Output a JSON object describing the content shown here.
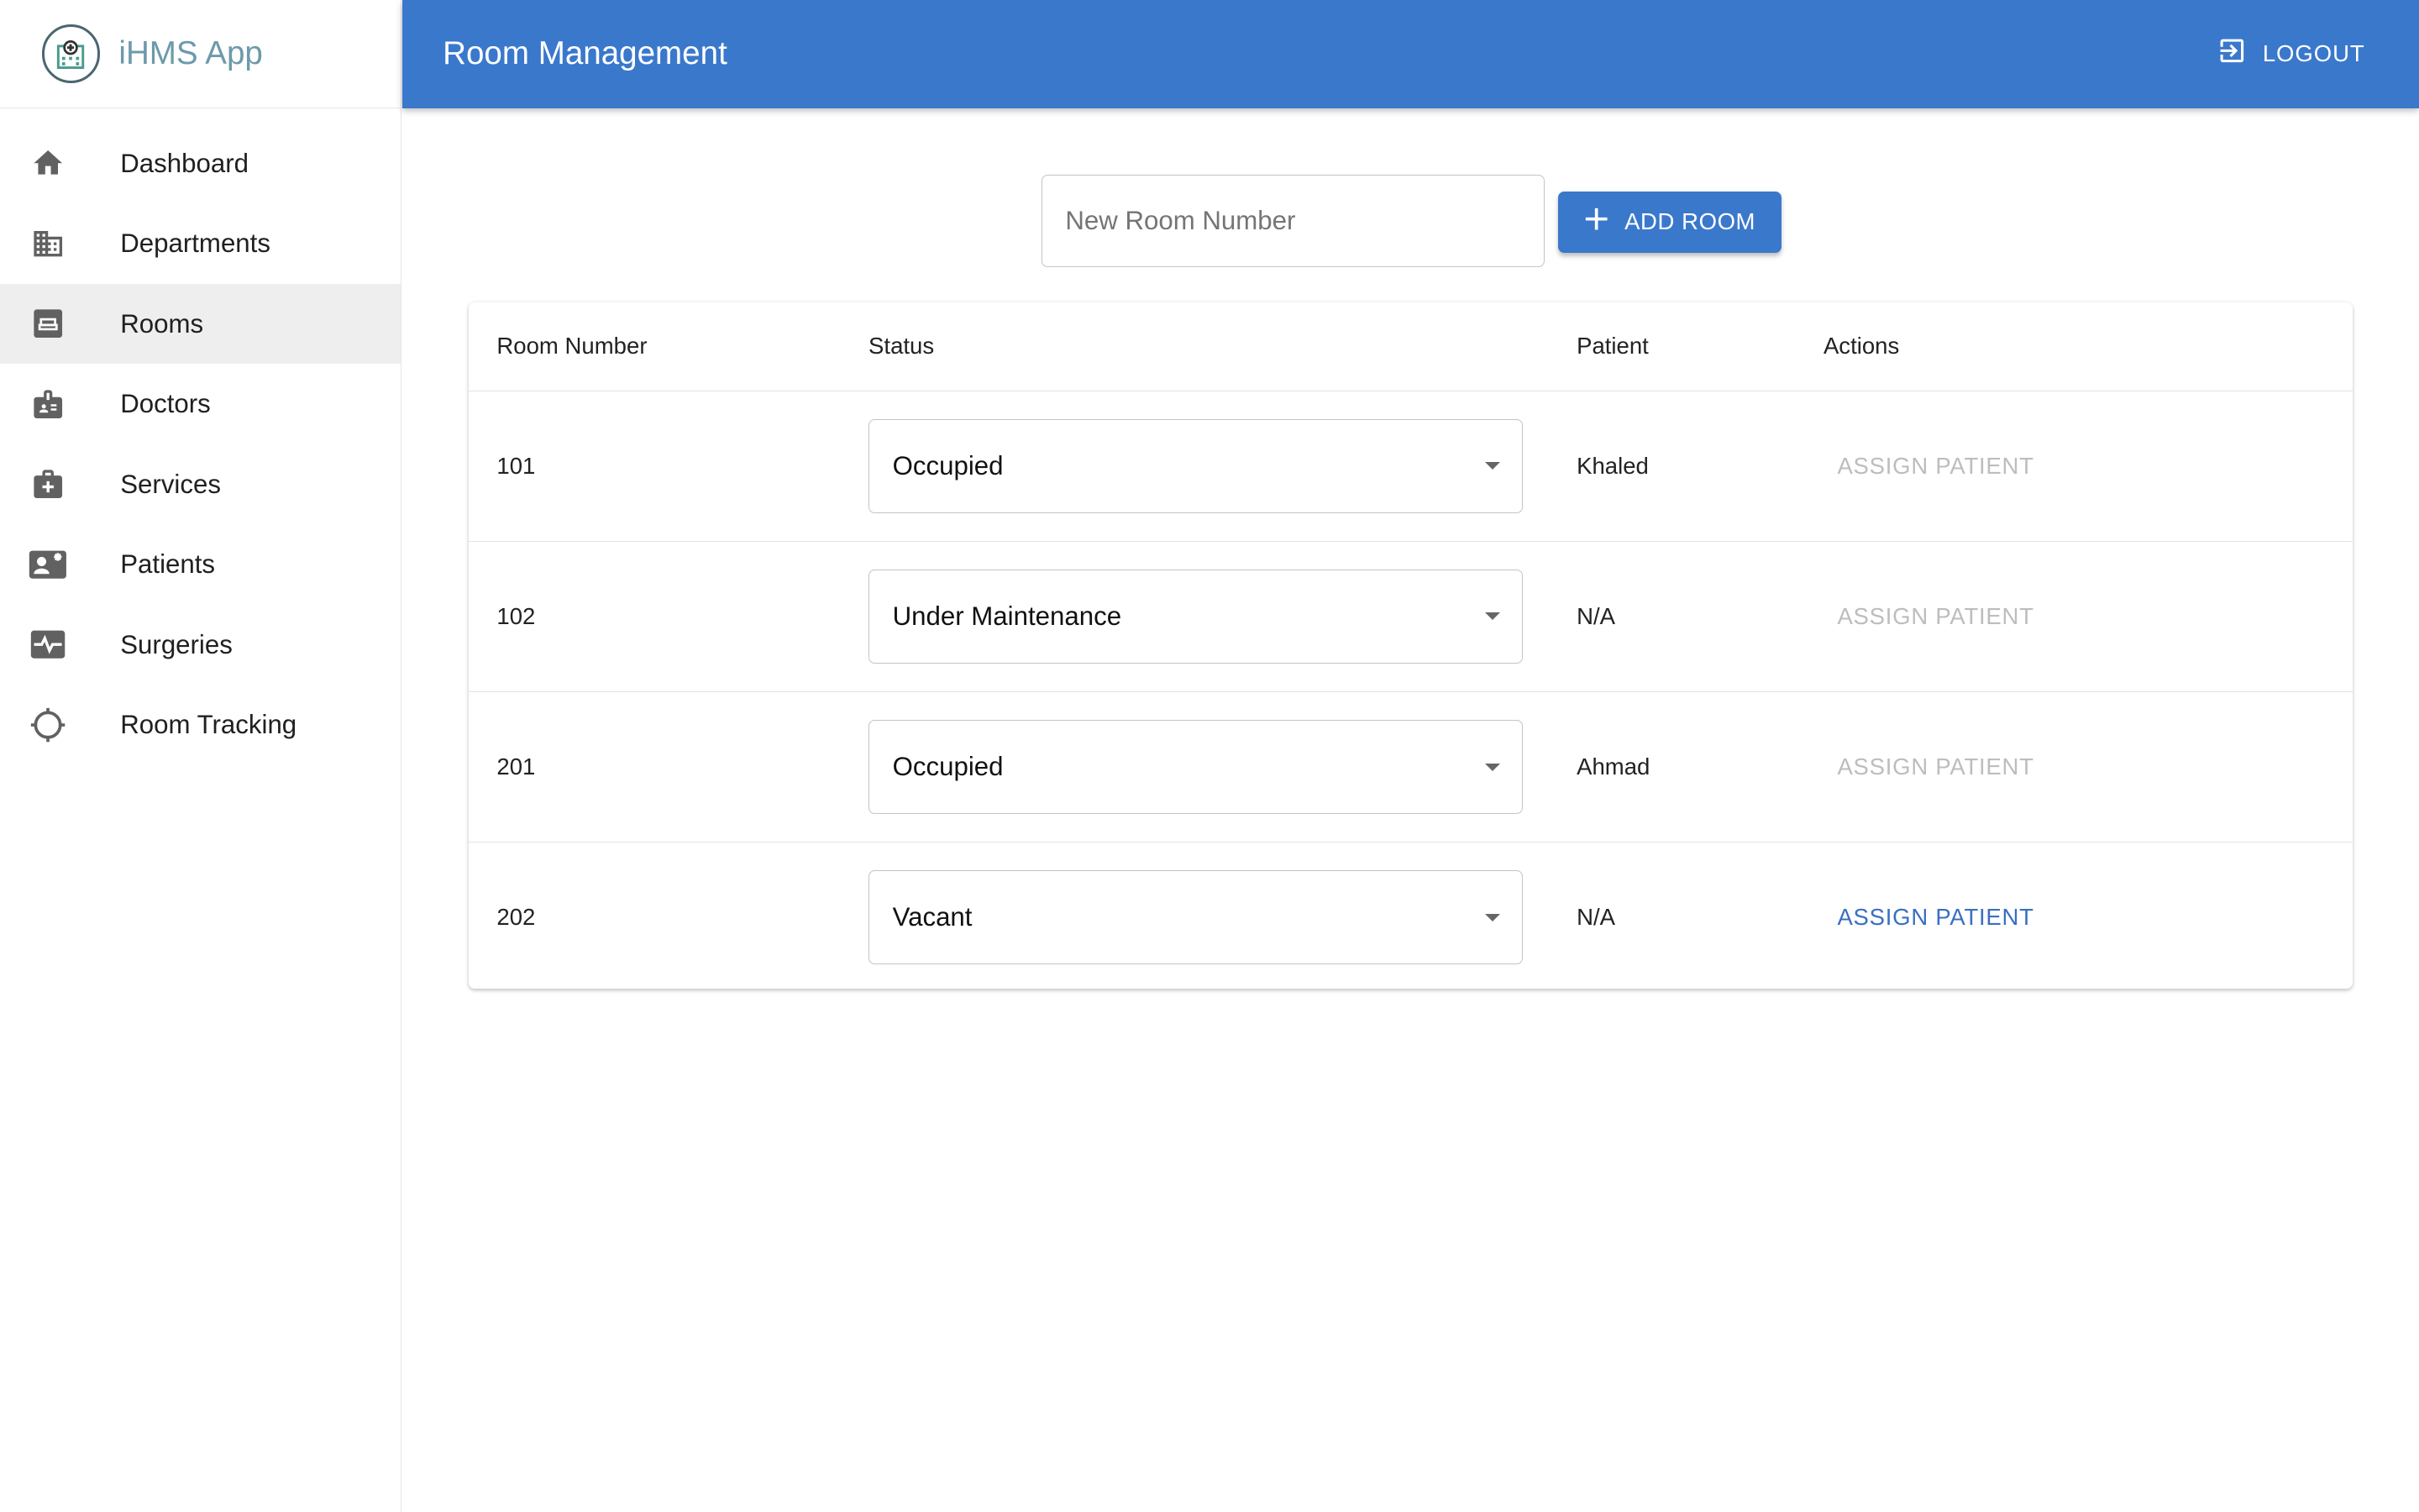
{
  "app": {
    "name": "iHMS App"
  },
  "sidebar": {
    "items": [
      {
        "label": "Dashboard",
        "icon": "home-icon"
      },
      {
        "label": "Departments",
        "icon": "building-icon"
      },
      {
        "label": "Rooms",
        "icon": "bed-icon",
        "active": true
      },
      {
        "label": "Doctors",
        "icon": "badge-icon"
      },
      {
        "label": "Services",
        "icon": "medical-kit-icon"
      },
      {
        "label": "Patients",
        "icon": "patient-card-icon"
      },
      {
        "label": "Surgeries",
        "icon": "monitor-heart-icon"
      },
      {
        "label": "Room Tracking",
        "icon": "crosshair-icon"
      }
    ]
  },
  "header": {
    "title": "Room Management",
    "logout_label": "LOGOUT"
  },
  "form": {
    "placeholder": "New Room Number",
    "add_label": "ADD ROOM"
  },
  "table": {
    "headers": [
      "Room Number",
      "Status",
      "Patient",
      "Actions"
    ],
    "rows": [
      {
        "room": "101",
        "status": "Occupied",
        "patient": "Khaled",
        "action": "ASSIGN PATIENT",
        "action_enabled": false
      },
      {
        "room": "102",
        "status": "Under Maintenance",
        "patient": "N/A",
        "action": "ASSIGN PATIENT",
        "action_enabled": false
      },
      {
        "room": "201",
        "status": "Occupied",
        "patient": "Ahmad",
        "action": "ASSIGN PATIENT",
        "action_enabled": false
      },
      {
        "room": "202",
        "status": "Vacant",
        "patient": "N/A",
        "action": "ASSIGN PATIENT",
        "action_enabled": true
      }
    ]
  },
  "colors": {
    "primary": "#3a78cc",
    "link": "#3a6fc2",
    "disabled": "#bdbdbd",
    "active_bg": "#eeeeee"
  }
}
